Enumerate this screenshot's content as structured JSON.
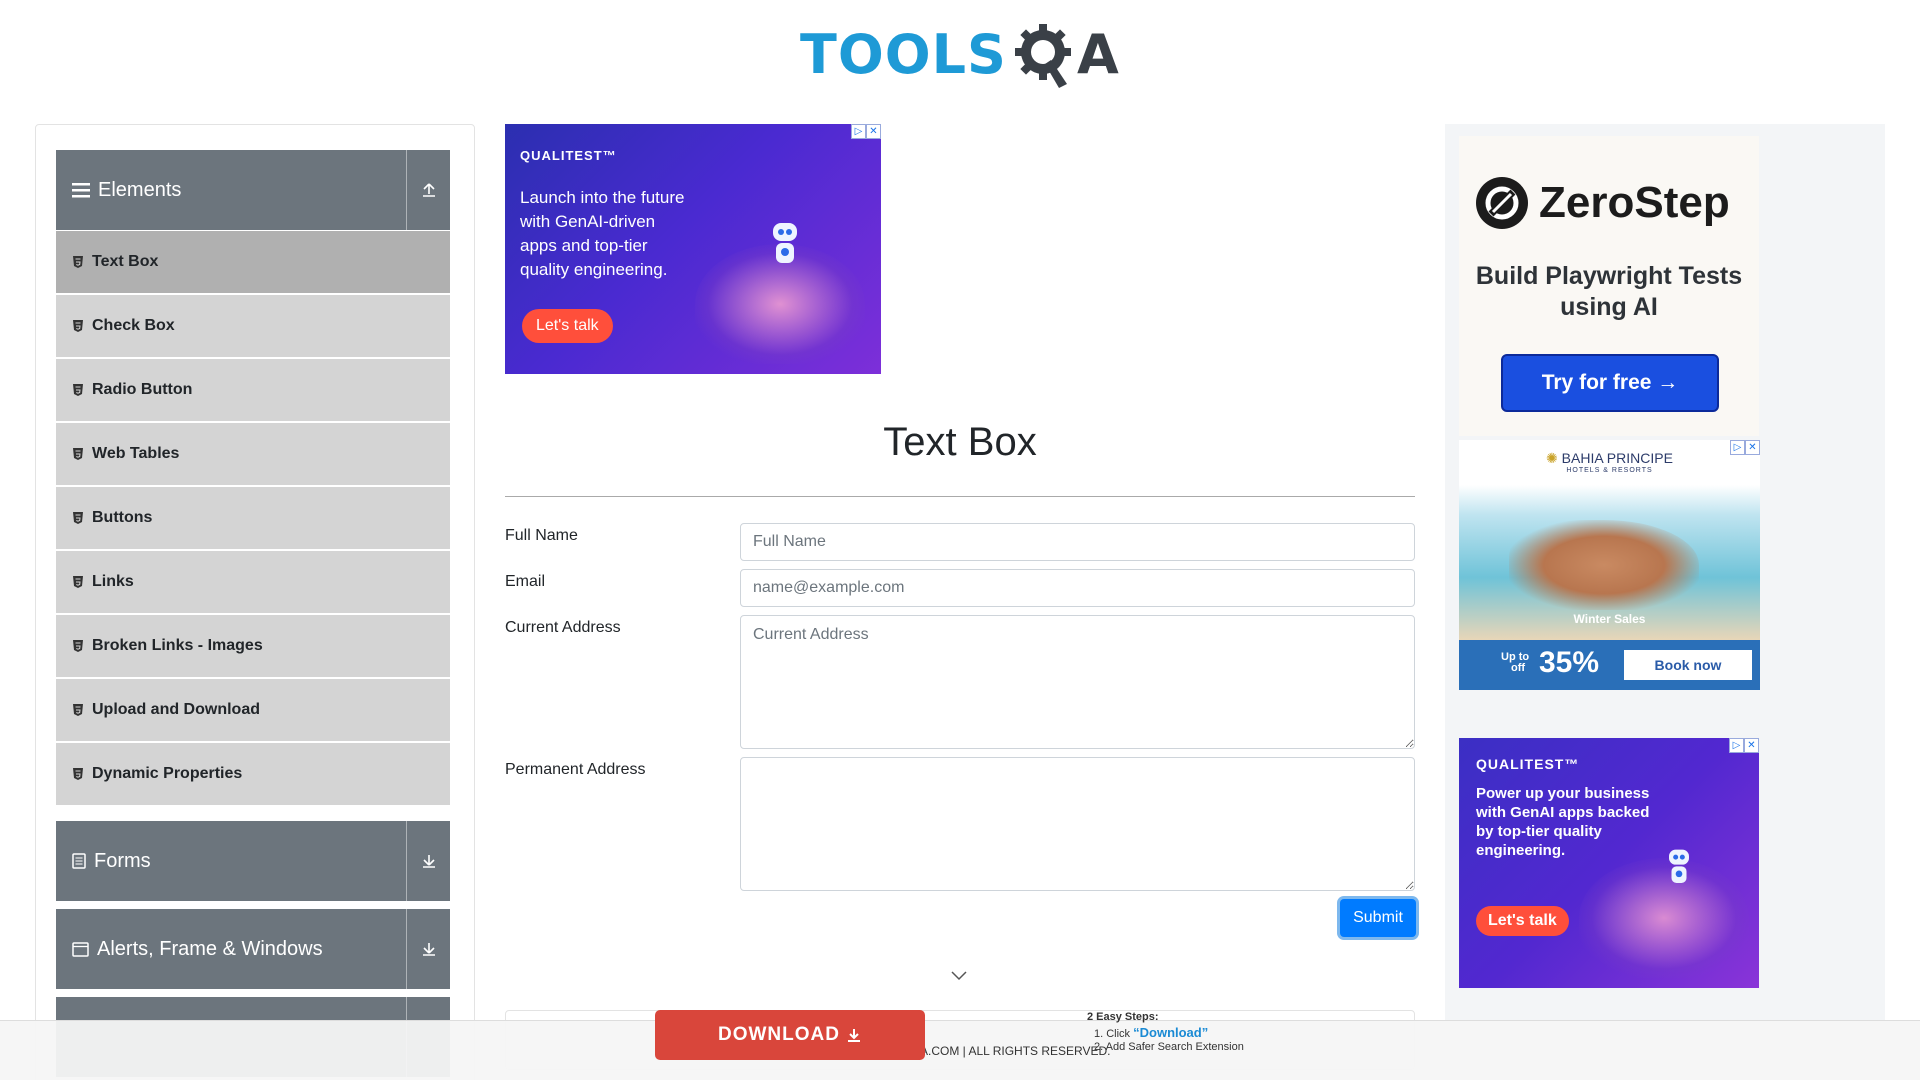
{
  "logo": {
    "part1": "TOOLS",
    "part2": "A"
  },
  "sidebar": {
    "elements_group": {
      "label": "Elements"
    },
    "items": [
      {
        "label": "Text Box"
      },
      {
        "label": "Check Box"
      },
      {
        "label": "Radio Button"
      },
      {
        "label": "Web Tables"
      },
      {
        "label": "Buttons"
      },
      {
        "label": "Links"
      },
      {
        "label": "Broken Links - Images"
      },
      {
        "label": "Upload and Download"
      },
      {
        "label": "Dynamic Properties"
      }
    ],
    "forms_group": {
      "label": "Forms"
    },
    "alerts_group": {
      "label": "Alerts, Frame & Windows"
    }
  },
  "ad_top": {
    "brand": "QUALITEST™",
    "copy": "Launch into the future with GenAI-driven apps and top-tier quality engineering.",
    "cta": "Let's talk",
    "robot_label": "Ai"
  },
  "main": {
    "title": "Text Box",
    "fields": {
      "full_name": {
        "label": "Full Name",
        "placeholder": "Full Name",
        "value": ""
      },
      "email": {
        "label": "Email",
        "placeholder": "name@example.com",
        "value": ""
      },
      "current_address": {
        "label": "Current Address",
        "placeholder": "Current Address",
        "value": ""
      },
      "permanent_address": {
        "label": "Permanent Address",
        "placeholder": "",
        "value": ""
      }
    },
    "submit_label": "Submit"
  },
  "ad_zero": {
    "brand": "ZeroStep",
    "sub": "Build Playwright Tests using AI",
    "cta": "Try for free →"
  },
  "ad_bahia": {
    "brand": "BAHIA PRINCIPE",
    "brand_sub": "HOTELS & RESORTS",
    "tagline": "Winter Sales",
    "upto": "Up to",
    "off": "off",
    "percent": "35%",
    "cta": "Book now"
  },
  "ad_qual2": {
    "brand": "QUALITEST™",
    "copy": "Power up your business with GenAI apps backed by top-tier quality engineering.",
    "cta": "Let's talk",
    "robot_label": "Ai"
  },
  "footer": {
    "text": "A.COM | ALL RIGHTS RESERVED."
  },
  "download_banner": {
    "button": "DOWNLOAD",
    "steps_title": "2 Easy Steps:",
    "step1_prefix": "1. Click ",
    "step1_link": "“Download”",
    "step2": "2. Add Safer Search Extension"
  },
  "colors": {
    "logo_blue": "#1e9ad6",
    "sidebar_header": "#6c757d",
    "submit": "#007bff",
    "download": "#d9463b"
  }
}
